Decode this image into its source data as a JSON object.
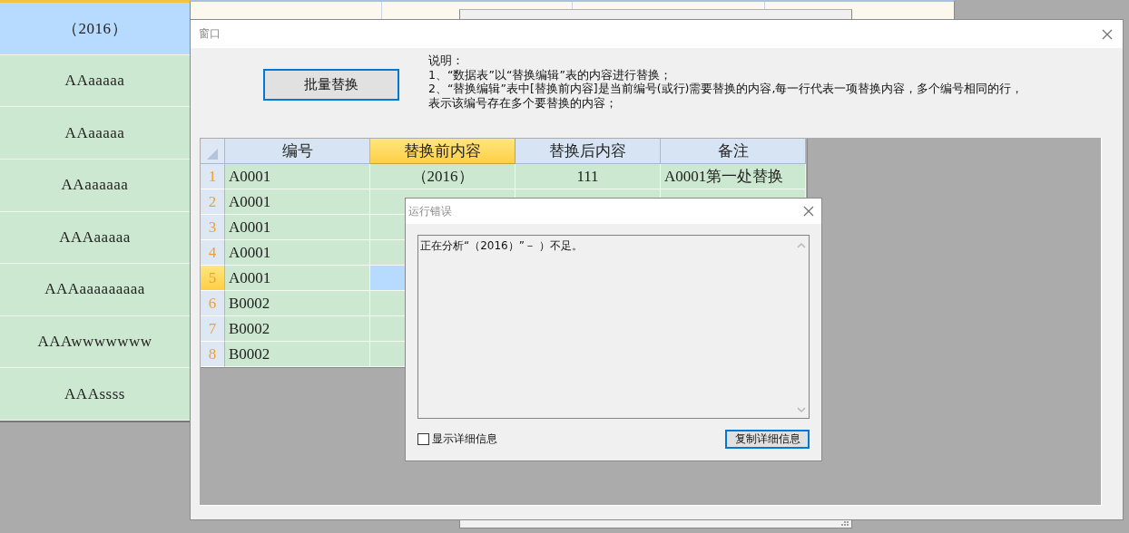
{
  "left_list": {
    "items": [
      {
        "text": "（2016）",
        "selected": true
      },
      {
        "text": "AAaaaaa",
        "selected": false
      },
      {
        "text": "AAaaaaa",
        "selected": false
      },
      {
        "text": "AAaaaaaa",
        "selected": false
      },
      {
        "text": "AAAaaaaa",
        "selected": false
      },
      {
        "text": "AAAaaaaaaaaa",
        "selected": false
      },
      {
        "text": "AAAwwwwwww",
        "selected": false
      },
      {
        "text": "AAAssss",
        "selected": false
      }
    ]
  },
  "main_window": {
    "title": "窗口",
    "button": "批量替换",
    "description": [
      "说明：",
      "1、“数据表”以“替换编辑”表的内容进行替换；",
      "2、“替换编辑”表中[替换前内容]是当前编号(或行)需要替换的内容,每一行代表一项替换内容，多个编号相同的行，",
      "表示该编号存在多个要替换的内容；"
    ],
    "table": {
      "columns": [
        {
          "label": "编号",
          "selected": false
        },
        {
          "label": "替换前内容",
          "selected": true
        },
        {
          "label": "替换后内容",
          "selected": false
        },
        {
          "label": "备注",
          "selected": false
        }
      ],
      "rows": [
        {
          "number": "1",
          "selected": false,
          "cells": [
            {
              "text": "A0001",
              "selected": false
            },
            {
              "text": "（2016）",
              "selected": false
            },
            {
              "text": "111",
              "selected": false
            },
            {
              "text": "A0001第一处替换",
              "selected": false
            }
          ]
        },
        {
          "number": "2",
          "selected": false,
          "cells": [
            {
              "text": "A0001",
              "selected": false
            },
            {
              "selected": false
            }
          ]
        },
        {
          "number": "3",
          "selected": false,
          "cells": [
            {
              "text": "A0001",
              "selected": false
            },
            {
              "selected": false
            }
          ]
        },
        {
          "number": "4",
          "selected": false,
          "cells": [
            {
              "text": "A0001",
              "selected": false
            },
            {
              "selected": false
            }
          ]
        },
        {
          "number": "5",
          "selected": true,
          "cells": [
            {
              "text": "A0001",
              "selected": false
            },
            {
              "selected": true
            }
          ]
        },
        {
          "number": "6",
          "selected": false,
          "cells": [
            {
              "text": "B0002",
              "selected": false
            },
            {
              "selected": false
            }
          ]
        },
        {
          "number": "7",
          "selected": false,
          "cells": [
            {
              "text": "B0002",
              "selected": false
            },
            {
              "selected": false
            }
          ]
        },
        {
          "number": "8",
          "selected": false,
          "cells": [
            {
              "text": "B0002",
              "selected": false
            },
            {
              "selected": false
            }
          ]
        }
      ]
    }
  },
  "error_dialog": {
    "title": "运行错误",
    "message": "正在分析“（2016）”－ ）不足。",
    "show_details": {
      "label": "显示详细信息",
      "checked": false
    },
    "copy_button": "复制详细信息"
  }
}
